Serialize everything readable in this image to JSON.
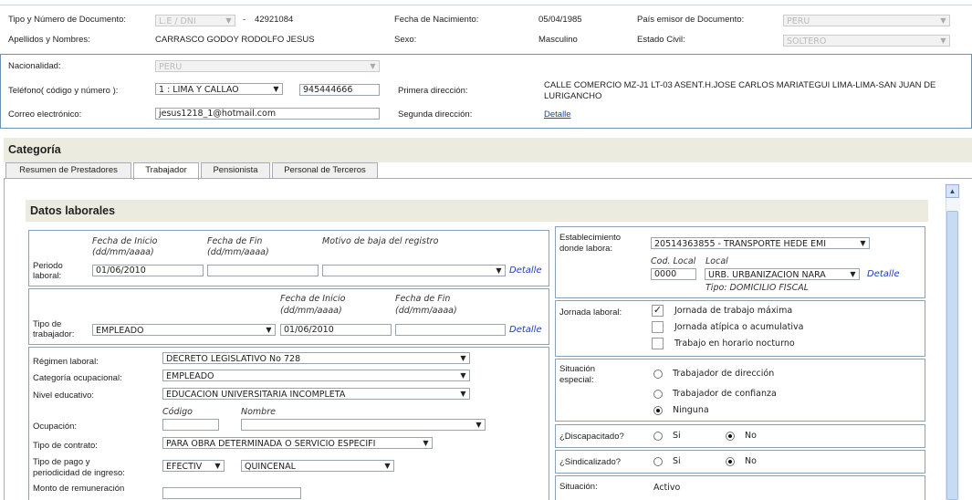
{
  "persona": {
    "tipo_doc_label": "Tipo y Número de Documento:",
    "tipo_doc_value": "L.E / DNI",
    "dash": "-",
    "num_doc": "42921084",
    "fecha_nac_label": "Fecha de Nacimiento:",
    "fecha_nac_value": "05/04/1985",
    "pais_label": "País emisor de Documento:",
    "pais_value": "PERU",
    "apellidos_label": "Apellidos y Nombres:",
    "apellidos_value": "CARRASCO GODOY RODOLFO JESUS",
    "sexo_label": "Sexo:",
    "sexo_value": "Masculino",
    "estado_civil_label": "Estado Civil:",
    "estado_civil_value": "SOLTERO"
  },
  "contacto": {
    "nacionalidad_label": "Nacionalidad:",
    "nacionalidad_value": "PERU",
    "telefono_label": "Teléfono( código y número ):",
    "telefono_codigo": "1 : LIMA Y CALLAO",
    "telefono_numero": "945444666",
    "primera_dir_label": "Primera dirección:",
    "primera_dir_value": "CALLE COMERCIO MZ-J1 LT-03 ASENT.H.JOSE CARLOS MARIATEGUI LIMA-LIMA-SAN JUAN DE LURIGANCHO",
    "correo_label": "Correo electrónico:",
    "correo_value": "jesus1218_1@hotmail.com",
    "segunda_dir_label": "Segunda dirección:",
    "segunda_dir_link": "Detalle"
  },
  "categoria": {
    "title": "Categoría",
    "tabs": [
      "Resumen de Prestadores",
      "Trabajador",
      "Pensionista",
      "Personal de Terceros"
    ]
  },
  "datos": {
    "title": "Datos laborales",
    "periodo": {
      "fecha_inicio_label": "Fecha de Inicio",
      "fecha_fin_label": "Fecha de Fin",
      "fmt": "(dd/mm/aaaa)",
      "motivo_label": "Motivo de baja del registro",
      "label1": "Periodo",
      "label2": "laboral:",
      "inicio_value": "01/06/2010",
      "detalle": "Detalle"
    },
    "tipo_trab": {
      "fecha_inicio_label": "Fecha de Inicio",
      "fecha_fin_label": "Fecha de Fin",
      "fmt": "(dd/mm/aaaa)",
      "label1": "Tipo de",
      "label2": "trabajador:",
      "value": "EMPLEADO",
      "inicio_value": "01/06/2010",
      "detalle": "Detalle"
    },
    "regimen_label": "Régimen laboral:",
    "regimen_value": "DECRETO LEGISLATIVO No 728",
    "categoria_label": "Categoría ocupacional:",
    "categoria_value": "EMPLEADO",
    "nivel_label": "Nivel educativo:",
    "nivel_value": "EDUCACION UNIVERSITARIA INCOMPLETA",
    "codigo_label": "Código",
    "nombre_label": "Nombre",
    "ocupacion_label": "Ocupación:",
    "contrato_label": "Tipo de contrato:",
    "contrato_value": "PARA OBRA DETERMINADA O SERVICIO ESPECIFI",
    "pago_label1": "Tipo de pago y",
    "pago_label2": "periodicidad de ingreso:",
    "pago_value": "EFECTIV",
    "periodicidad_value": "QUINCENAL",
    "monto_label": "Monto de remuneración"
  },
  "derecha": {
    "estab_label1": "Establecimiento",
    "estab_label2": "donde labora:",
    "estab_value": "20514363855 - TRANSPORTE HEDE EMI",
    "cod_label": "Cod. Local",
    "local_label": "Local",
    "cod_value": "0000",
    "local_value": "URB. URBANIZACION NARA",
    "detalle": "Detalle",
    "tipo_local": "Tipo: DOMICILIO FISCAL",
    "jornada_label": "Jornada laboral:",
    "jornada_opts": [
      "Jornada de trabajo máxima",
      "Jornada atípica o acumulativa",
      "Trabajo en horario nocturno"
    ],
    "jornada_check_mark": "✓",
    "situacion_esp_label1": "Situación",
    "situacion_esp_label2": "especial:",
    "situacion_opts": [
      "Trabajador de dirección",
      "Trabajador de confianza",
      "Ninguna"
    ],
    "discapacitado_label": "¿Discapacitado?",
    "sindicalizado_label": "¿Sindicalizado?",
    "si": "Si",
    "no": "No",
    "situacion_label": "Situación:",
    "situacion_value": "Activo"
  },
  "scrollbar": {
    "up": "▲"
  }
}
